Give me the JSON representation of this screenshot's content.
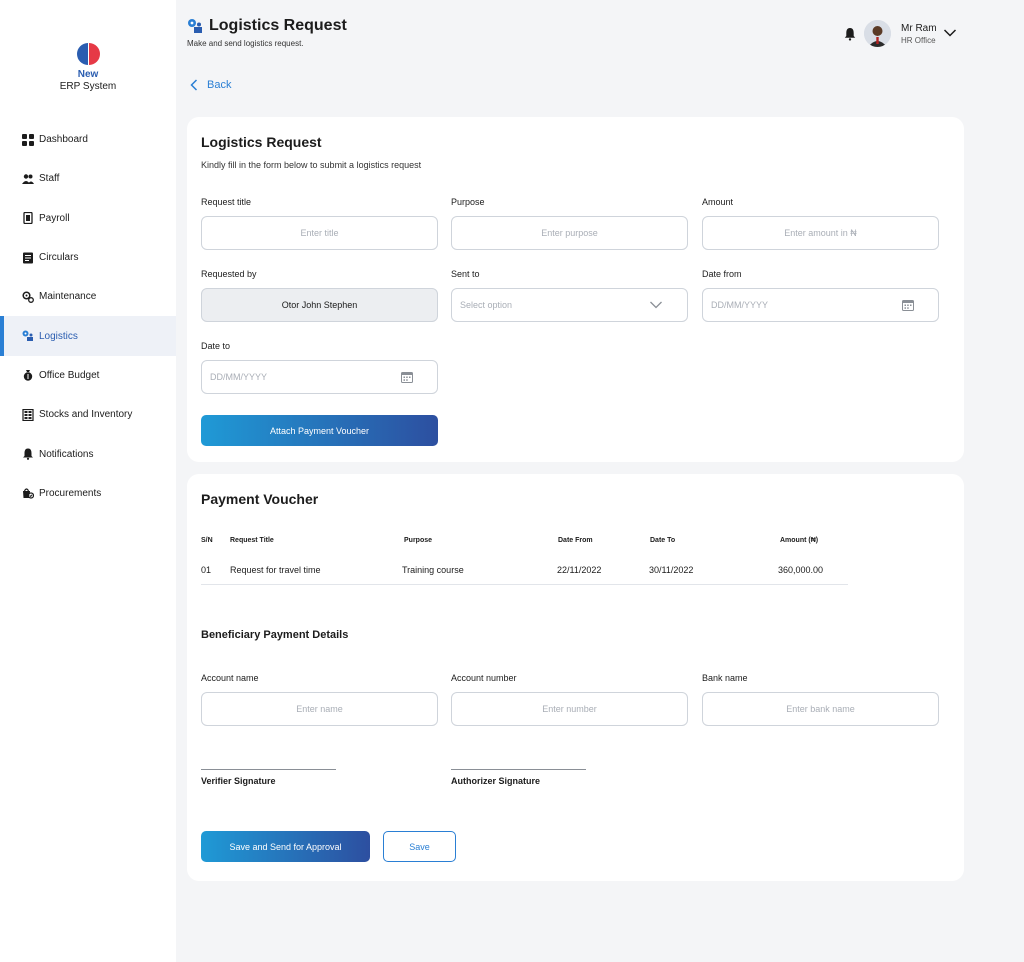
{
  "app": {
    "logo_line1": "New",
    "logo_line2": "ERP System"
  },
  "sidebar": {
    "items": [
      {
        "label": "Dashboard",
        "icon": "dashboard-icon"
      },
      {
        "label": "Staff",
        "icon": "staff-icon"
      },
      {
        "label": "Payroll",
        "icon": "payroll-icon"
      },
      {
        "label": "Circulars",
        "icon": "circulars-icon"
      },
      {
        "label": "Maintenance",
        "icon": "maintenance-icon"
      },
      {
        "label": "Logistics",
        "icon": "logistics-icon",
        "active": true
      },
      {
        "label": "Office Budget",
        "icon": "budget-icon"
      },
      {
        "label": "Stocks and Inventory",
        "icon": "inventory-icon"
      },
      {
        "label": "Notifications",
        "icon": "bell-icon"
      },
      {
        "label": "Procurements",
        "icon": "procurements-icon"
      }
    ]
  },
  "header": {
    "title": "Logistics Request",
    "subtitle": "Make and send logistics request.",
    "user_name": "Mr Ram",
    "user_role": "HR Office"
  },
  "back_label": "Back",
  "form": {
    "title": "Logistics Request",
    "subtitle": "Kindly fill in the form below to submit a logistics request",
    "request_title": {
      "label": "Request title",
      "placeholder": "Enter title"
    },
    "purpose": {
      "label": "Purpose",
      "placeholder": "Enter purpose"
    },
    "amount": {
      "label": "Amount",
      "placeholder": "Enter amount in ₦"
    },
    "requested_by": {
      "label": "Requested by",
      "value": "Otor John Stephen"
    },
    "sent_to": {
      "label": "Sent to",
      "placeholder": "Select option"
    },
    "date_from": {
      "label": "Date from",
      "placeholder": "DD/MM/YYYY"
    },
    "date_to": {
      "label": "Date to",
      "placeholder": "DD/MM/YYYY"
    },
    "attach_button": "Attach Payment Voucher"
  },
  "voucher": {
    "title": "Payment Voucher",
    "columns": [
      "S/N",
      "Request Title",
      "Purpose",
      "Date From",
      "Date To",
      "Amount (₦)"
    ],
    "rows": [
      [
        "01",
        "Request for travel time",
        "Training course",
        "22/11/2022",
        "30/11/2022",
        "360,000.00"
      ]
    ],
    "beneficiary_title": "Beneficiary Payment Details",
    "account_name": {
      "label": "Account name",
      "placeholder": "Enter name"
    },
    "account_number": {
      "label": "Account number",
      "placeholder": "Enter number"
    },
    "bank_name": {
      "label": "Bank name",
      "placeholder": "Enter bank name"
    },
    "verifier_signature": "Verifier Signature",
    "authorizer_signature": "Authorizer Signature",
    "save_send_button": "Save and Send for Approval",
    "save_button": "Save"
  },
  "colors": {
    "accent": "#2a7fd4",
    "gradient_start": "#1f9ad6",
    "gradient_end": "#2d4fa0",
    "background": "#f4f5f7"
  }
}
